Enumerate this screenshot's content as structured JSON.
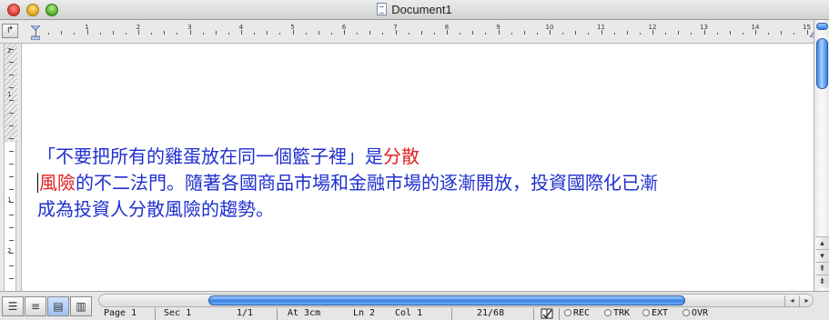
{
  "window": {
    "title": "Document1",
    "icons": {
      "close": "close-button",
      "minimize": "minimize-button",
      "zoom": "zoom-button",
      "doc": "document-icon"
    }
  },
  "ruler": {
    "tab_selector": "↱",
    "numbers": [
      "1",
      "2",
      "3",
      "4",
      "5",
      "6",
      "7",
      "8",
      "9",
      "10",
      "11",
      "12",
      "13",
      "14",
      "15"
    ],
    "vertical_numbers": [
      "2",
      "1",
      "1",
      "2"
    ]
  },
  "document": {
    "line1_blue": "「不要把所有的雞蛋放在同一個籃子裡」是",
    "line1_red": "分散",
    "line2_red": "風險",
    "line2_blue": "的不二法門。隨著各國商品市場和金融市場的逐漸開放，投資國際化已漸",
    "line3_blue": "成為投資人分散風險的趨勢。"
  },
  "colors": {
    "blue_text": "#1f2fd0",
    "red_text": "#e02020",
    "scroll_accent": "#3a80e0"
  },
  "status_bar": {
    "page": "Page 1",
    "section": "Sec 1",
    "page_of": "1/1",
    "at": "At 3cm",
    "line": "Ln 2",
    "column": "Col 1",
    "word_count": "21/68",
    "modes": [
      "REC",
      "TRK",
      "EXT",
      "OVR"
    ]
  },
  "view_buttons": [
    "draft-view",
    "outline-view",
    "page-layout-view",
    "notebook-view"
  ],
  "scroll_arrows": {
    "left": "◂",
    "right": "▸",
    "up": "▴",
    "down": "▾"
  }
}
